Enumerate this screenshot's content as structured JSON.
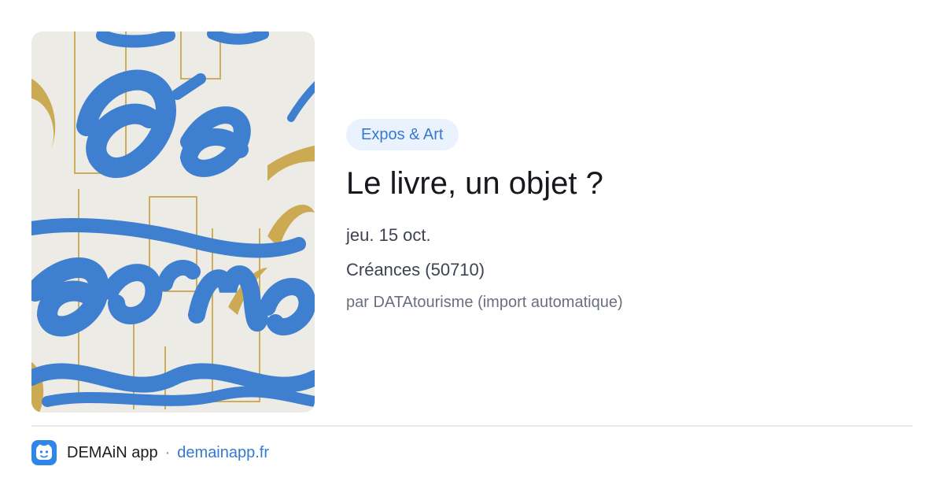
{
  "event": {
    "category": "Expos & Art",
    "title": "Le livre, un objet ?",
    "date": "jeu. 15 oct.",
    "place": "Créances (50710)",
    "author": "par DATAtourisme (import automatique)"
  },
  "cover": {
    "lettering_top": "Dé",
    "lettering_bottom": "forme"
  },
  "footer": {
    "app_name": "DEMAiN app",
    "separator": "·",
    "site": "demainapp.fr",
    "icon": "app-logo-icon"
  },
  "colors": {
    "accent": "#3579d0",
    "badge_bg": "#eaf2fd",
    "divider": "#e3e9ec",
    "cover_blue": "#3f7fd0",
    "cover_gold": "#c9a342"
  }
}
